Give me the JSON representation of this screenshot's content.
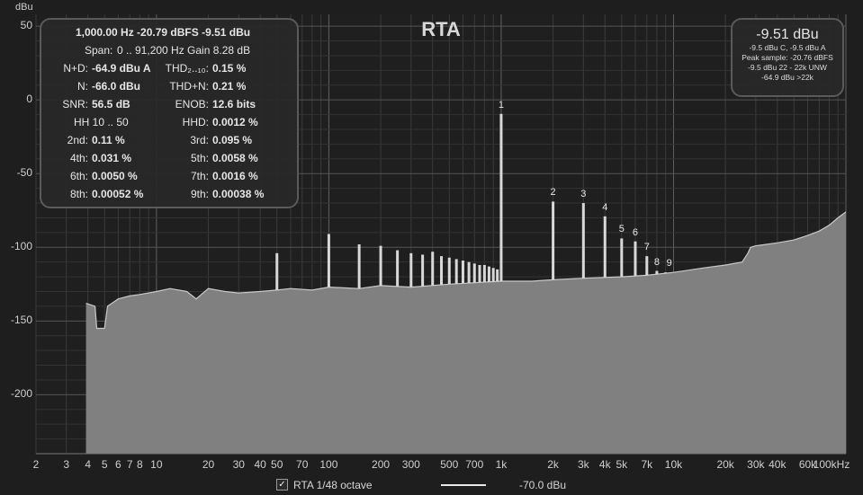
{
  "title": "RTA",
  "colors": {
    "background": "#1e1e1e",
    "plot_bg": "#1f1f1f",
    "grid": "#3a3a3a",
    "fill": "#808080",
    "line": "#e0e0e0"
  },
  "stats_panel": {
    "rows": [
      [
        {
          "label": "",
          "value": "1,000.00 Hz  -20.79 dBFS  -9.51 dBu"
        }
      ],
      [
        {
          "label": "Span:",
          "value": "0 .. 91,200 Hz   Gain 8.28 dB"
        }
      ],
      [
        {
          "label": "N+D:",
          "value": "-64.9 dBu A"
        },
        {
          "label": "THD₂..₁₀:",
          "value": "0.15 %"
        }
      ],
      [
        {
          "label": "N:",
          "value": "-66.0 dBu"
        },
        {
          "label": "THD+N:",
          "value": "0.21 %"
        }
      ],
      [
        {
          "label": "SNR:",
          "value": "56.5 dB"
        },
        {
          "label": "ENOB:",
          "value": "12.6 bits"
        }
      ],
      [
        {
          "label": "HH 10 .. 50",
          "value": ""
        },
        {
          "label": "HHD:",
          "value": "0.0012 %"
        }
      ],
      [
        {
          "label": "2nd:",
          "value": "0.11 %"
        },
        {
          "label": "3rd:",
          "value": "0.095 %"
        }
      ],
      [
        {
          "label": "4th:",
          "value": "0.031 %"
        },
        {
          "label": "5th:",
          "value": "0.0058 %"
        }
      ],
      [
        {
          "label": "6th:",
          "value": "0.0050 %"
        },
        {
          "label": "7th:",
          "value": "0.0016 %"
        }
      ],
      [
        {
          "label": "8th:",
          "value": "0.00052 %"
        },
        {
          "label": "9th:",
          "value": "0.00038 %"
        }
      ]
    ]
  },
  "readout_panel": {
    "main": "-9.51 dBu",
    "lines": [
      "-9.5 dBu C, -9.5 dBu A",
      "Peak sample: -20.76 dBFS",
      "-9.5 dBu 22 - 22k UNW",
      "-64.9 dBu >22k"
    ]
  },
  "legend": {
    "checked": "✓",
    "label": "RTA 1/48 octave",
    "value": "-70.0 dBu"
  },
  "chart_data": {
    "type": "area",
    "title": "RTA",
    "xlabel": "",
    "ylabel": "dBu",
    "xscale": "log",
    "xlim": [
      2,
      100000
    ],
    "ylim": [
      -240,
      58
    ],
    "grid": true,
    "x_ticks": [
      {
        "v": 2,
        "label": "2"
      },
      {
        "v": 3,
        "label": "3"
      },
      {
        "v": 4,
        "label": "4"
      },
      {
        "v": 5,
        "label": "5"
      },
      {
        "v": 6,
        "label": "6"
      },
      {
        "v": 7,
        "label": "7"
      },
      {
        "v": 8,
        "label": "8"
      },
      {
        "v": 10,
        "label": "10"
      },
      {
        "v": 20,
        "label": "20"
      },
      {
        "v": 30,
        "label": "30"
      },
      {
        "v": 40,
        "label": "40"
      },
      {
        "v": 50,
        "label": "50"
      },
      {
        "v": 70,
        "label": "70"
      },
      {
        "v": 100,
        "label": "100"
      },
      {
        "v": 200,
        "label": "200"
      },
      {
        "v": 300,
        "label": "300"
      },
      {
        "v": 500,
        "label": "500"
      },
      {
        "v": 700,
        "label": "700"
      },
      {
        "v": 1000,
        "label": "1k"
      },
      {
        "v": 2000,
        "label": "2k"
      },
      {
        "v": 3000,
        "label": "3k"
      },
      {
        "v": 4000,
        "label": "4k"
      },
      {
        "v": 5000,
        "label": "5k"
      },
      {
        "v": 7000,
        "label": "7k"
      },
      {
        "v": 10000,
        "label": "10k"
      },
      {
        "v": 20000,
        "label": "20k"
      },
      {
        "v": 30000,
        "label": "30k"
      },
      {
        "v": 40000,
        "label": "40k"
      },
      {
        "v": 60000,
        "label": "60k"
      },
      {
        "v": 100000,
        "label": "100kHz"
      }
    ],
    "y_ticks": [
      50,
      0,
      -50,
      -100,
      -150,
      -200
    ],
    "spectrum": {
      "x": [
        3.9,
        4.4,
        4.5,
        5,
        5.2,
        6,
        7,
        8,
        10,
        12,
        15,
        17,
        20,
        25,
        30,
        40,
        50,
        60,
        80,
        100,
        150,
        200,
        300,
        500,
        700,
        1000,
        1500,
        2000,
        3000,
        5000,
        7000,
        10000,
        15000,
        20000,
        25000,
        27000,
        28000,
        30000,
        40000,
        50000,
        60000,
        70000,
        80000,
        90000,
        100000
      ],
      "y": [
        -138,
        -140,
        -155,
        -155,
        -140,
        -135,
        -133,
        -132,
        -130,
        -128,
        -130,
        -135,
        -128,
        -130,
        -131,
        -130,
        -129,
        -128,
        -129,
        -127,
        -128,
        -126,
        -127,
        -125,
        -124,
        -123,
        -123,
        -122,
        -121,
        -120,
        -119,
        -117,
        -114,
        -112,
        -110,
        -104,
        -100,
        -99,
        -97,
        -95,
        -92,
        -89,
        -85,
        -80,
        -76
      ]
    },
    "peaks": [
      {
        "x": 50,
        "y": -104
      },
      {
        "x": 100,
        "y": -91
      },
      {
        "x": 150,
        "y": -98
      },
      {
        "x": 200,
        "y": -99
      },
      {
        "x": 250,
        "y": -102
      },
      {
        "x": 300,
        "y": -104
      },
      {
        "x": 350,
        "y": -105
      },
      {
        "x": 400,
        "y": -103
      },
      {
        "x": 450,
        "y": -106
      },
      {
        "x": 500,
        "y": -107
      },
      {
        "x": 550,
        "y": -108
      },
      {
        "x": 600,
        "y": -109
      },
      {
        "x": 650,
        "y": -110
      },
      {
        "x": 700,
        "y": -111
      },
      {
        "x": 750,
        "y": -112
      },
      {
        "x": 800,
        "y": -112
      },
      {
        "x": 850,
        "y": -113
      },
      {
        "x": 900,
        "y": -114
      },
      {
        "x": 950,
        "y": -115
      },
      {
        "x": 1000,
        "y": -9.5
      },
      {
        "x": 2000,
        "y": -69
      },
      {
        "x": 3000,
        "y": -70
      },
      {
        "x": 4000,
        "y": -79
      },
      {
        "x": 5000,
        "y": -94
      },
      {
        "x": 6000,
        "y": -96
      },
      {
        "x": 7000,
        "y": -106
      },
      {
        "x": 8000,
        "y": -116
      },
      {
        "x": 9000,
        "y": -117
      }
    ],
    "harmonic_labels": [
      {
        "n": "1",
        "x": 1000,
        "y": -9.5
      },
      {
        "n": "2",
        "x": 2000,
        "y": -69
      },
      {
        "n": "3",
        "x": 3000,
        "y": -70
      },
      {
        "n": "4",
        "x": 4000,
        "y": -79
      },
      {
        "n": "5",
        "x": 5000,
        "y": -94
      },
      {
        "n": "6",
        "x": 6000,
        "y": -96
      },
      {
        "n": "7",
        "x": 7000,
        "y": -106
      },
      {
        "n": "8",
        "x": 8000,
        "y": -116
      },
      {
        "n": "9",
        "x": 9000,
        "y": -117
      }
    ]
  }
}
